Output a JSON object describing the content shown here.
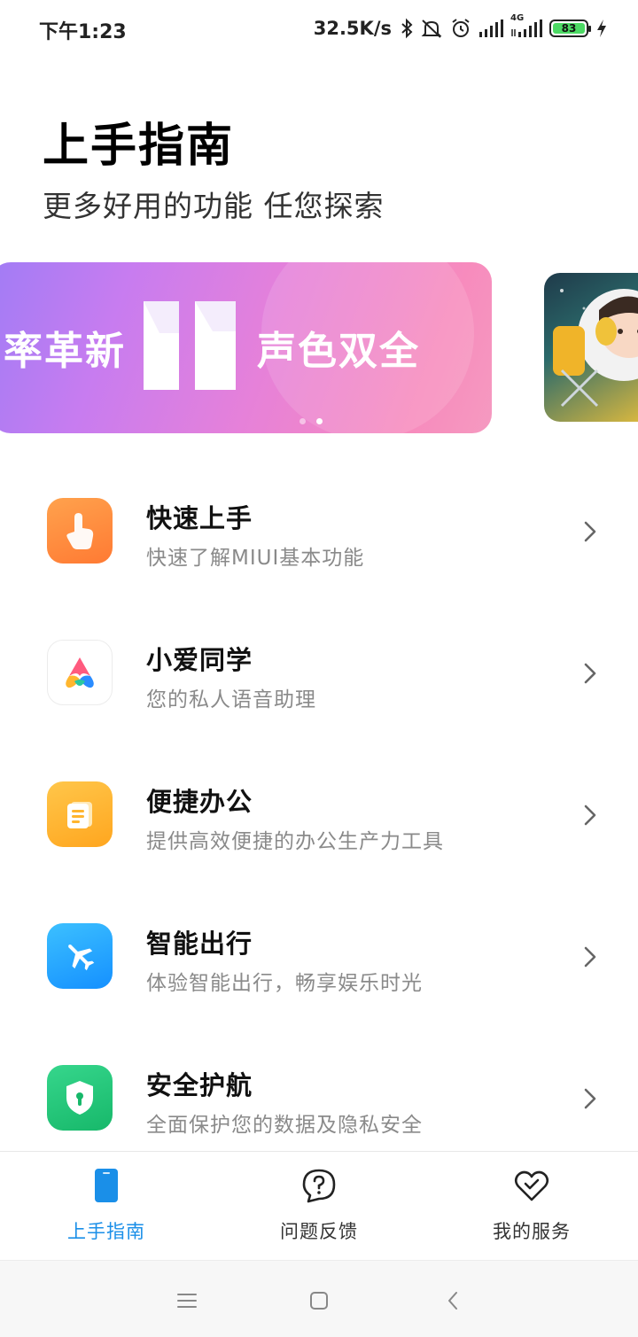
{
  "status_bar": {
    "time": "下午1:23",
    "net_speed": "32.5K/s",
    "network_label": "4G",
    "battery": "83",
    "icons": [
      "bluetooth-icon",
      "mute-icon",
      "alarm-icon",
      "signal-icon",
      "signal-4g-icon",
      "battery-icon",
      "charging-icon"
    ]
  },
  "header": {
    "title": "上手指南",
    "subtitle": "更多好用的功能 任您探索"
  },
  "banner": {
    "text_left": "率革新",
    "text_right": "声色双全",
    "slide_count": 2,
    "active_slide": 2,
    "colors": {
      "start": "#a17cf5",
      "end": "#f59ac0"
    }
  },
  "items": [
    {
      "title": "快速上手",
      "desc": "快速了解MIUI基本功能",
      "icon": "tap-hand-icon",
      "color": "#ff8a3d"
    },
    {
      "title": "小爱同学",
      "desc": "您的私人语音助理",
      "icon": "xiaoai-icon",
      "color": "#ffffff"
    },
    {
      "title": "便捷办公",
      "desc": "提供高效便捷的办公生产力工具",
      "icon": "notes-icon",
      "color": "#ffb52e"
    },
    {
      "title": "智能出行",
      "desc": "体验智能出行，畅享娱乐时光",
      "icon": "airplane-icon",
      "color": "#1aa3ff"
    },
    {
      "title": "安全护航",
      "desc": "全面保护您的数据及隐私安全",
      "icon": "shield-icon",
      "color": "#22c37a"
    }
  ],
  "tabs": [
    {
      "label": "上手指南",
      "icon": "phone-icon",
      "active": true
    },
    {
      "label": "问题反馈",
      "icon": "question-bubble-icon",
      "active": false
    },
    {
      "label": "我的服务",
      "icon": "heart-check-icon",
      "active": false
    }
  ],
  "accent_color": "#1a8fe8"
}
